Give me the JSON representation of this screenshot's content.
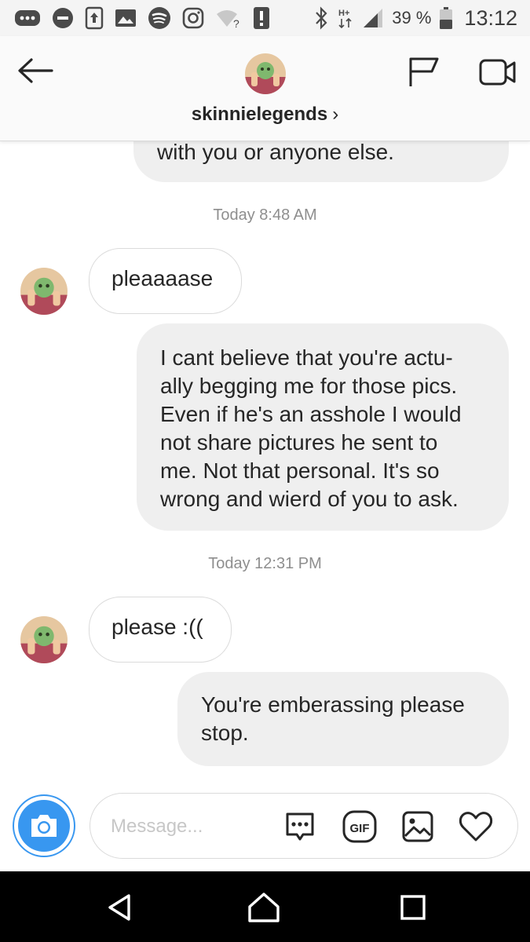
{
  "status_bar": {
    "battery": "39 %",
    "time": "13:12",
    "network": "H+",
    "icons": [
      "more-icon",
      "do-not-disturb-icon",
      "upload-icon",
      "gallery-icon",
      "spotify-icon",
      "instagram-icon",
      "wifi-unknown-icon",
      "alert-icon",
      "bluetooth-icon",
      "signal-icon",
      "battery-icon"
    ]
  },
  "header": {
    "username": "skinnielegends",
    "chevron": "›",
    "icons": [
      "back-arrow-icon",
      "flag-icon",
      "video-call-icon"
    ]
  },
  "chat": {
    "partial_sent": "with you or anyone else.",
    "ts1": "Today 8:48 AM",
    "recv1": "pleaaaase",
    "sent1_lines": [
      "I cant believe that you're actu-",
      "ally begging me for those pics.",
      "Even if he's an asshole I would",
      "not share pictures he sent to",
      "me. Not that personal. It's so",
      "wrong and wierd of you to ask."
    ],
    "ts2": "Today 12:31 PM",
    "recv2": "please :((",
    "sent2_lines": [
      "You're emberassing please",
      "stop."
    ]
  },
  "composer": {
    "placeholder": "Message...",
    "gif_label": "GIF",
    "accent": "#3897f0",
    "icons": [
      "camera-icon",
      "chat-bubble-icon",
      "gif-icon",
      "image-icon",
      "heart-icon"
    ]
  },
  "nav": {
    "icons": [
      "back-triangle-icon",
      "home-icon",
      "recents-icon"
    ]
  }
}
